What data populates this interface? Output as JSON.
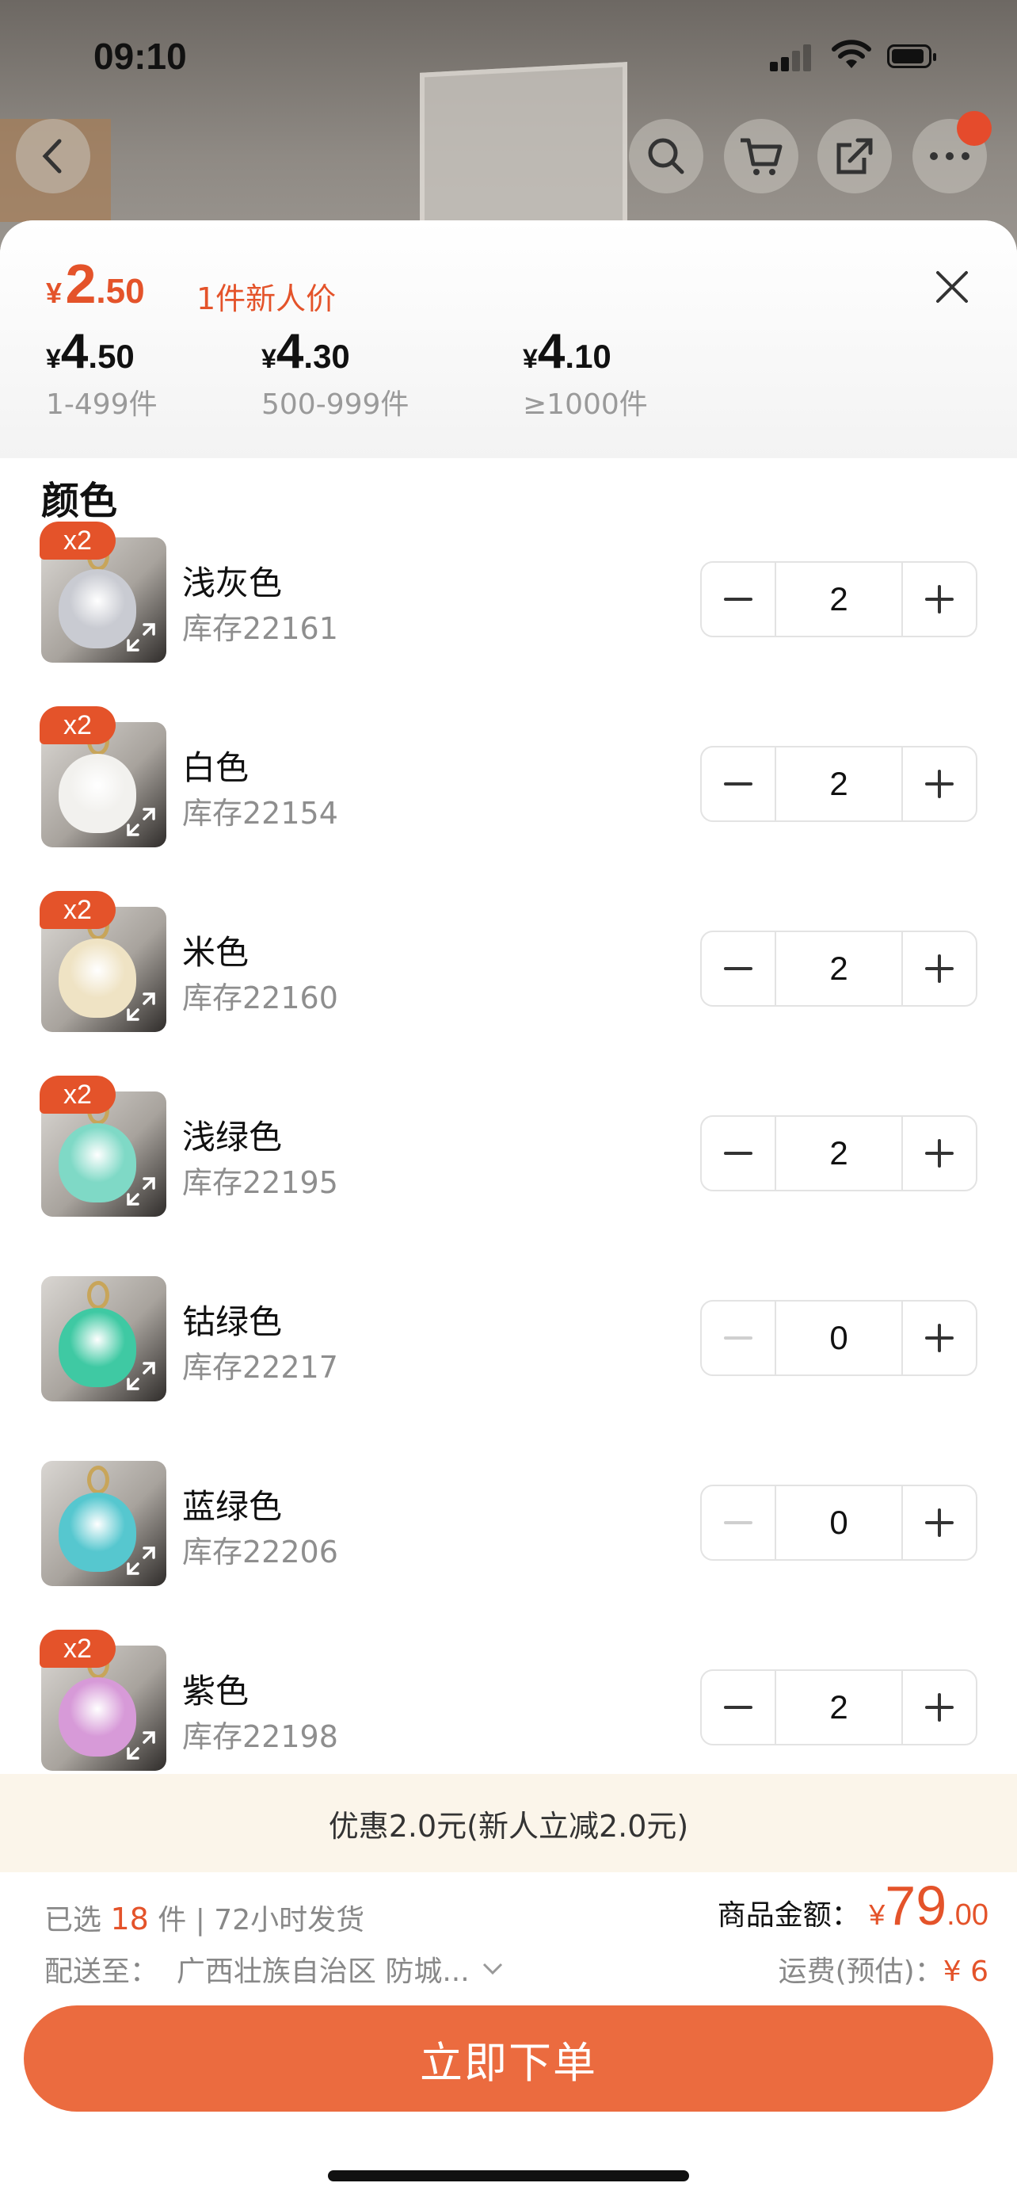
{
  "status": {
    "time": "09:10"
  },
  "header_icons": [
    "back-icon",
    "search-icon",
    "cart-icon",
    "share-icon",
    "more-icon"
  ],
  "price": {
    "currency": "¥",
    "current_int": "2",
    "current_dec": ".50",
    "new_user_label": "1件新人价",
    "tiers": [
      {
        "currency": "¥",
        "int": "4",
        "dec": ".50",
        "range": "1-499件"
      },
      {
        "currency": "¥",
        "int": "4",
        "dec": ".30",
        "range": "500-999件"
      },
      {
        "currency": "¥",
        "int": "4",
        "dec": ".10",
        "range": "≥1000件"
      }
    ]
  },
  "color_section": {
    "title": "颜色"
  },
  "variants": [
    {
      "tag": "x2",
      "name": "浅灰色",
      "stock": "库存22161",
      "qty": "2",
      "toy_color": "#c9cbd2",
      "minus_active": true
    },
    {
      "tag": "x2",
      "name": "白色",
      "stock": "库存22154",
      "qty": "2",
      "toy_color": "#f2f1ee",
      "minus_active": true
    },
    {
      "tag": "x2",
      "name": "米色",
      "stock": "库存22160",
      "qty": "2",
      "toy_color": "#efe3c4",
      "minus_active": true
    },
    {
      "tag": "x2",
      "name": "浅绿色",
      "stock": "库存22195",
      "qty": "2",
      "toy_color": "#7fd9c6",
      "minus_active": true
    },
    {
      "tag": "",
      "name": "钴绿色",
      "stock": "库存22217",
      "qty": "0",
      "toy_color": "#3fc9a3",
      "minus_active": false
    },
    {
      "tag": "",
      "name": "蓝绿色",
      "stock": "库存22206",
      "qty": "0",
      "toy_color": "#56c7cf",
      "minus_active": false
    },
    {
      "tag": "x2",
      "name": "紫色",
      "stock": "库存22198",
      "qty": "2",
      "toy_color": "#d79ad8",
      "minus_active": true
    }
  ],
  "promo": "优惠2.0元(新人立减2.0元)",
  "summary": {
    "selected_prefix": "已选",
    "selected_count": "18",
    "selected_suffix": "件 | 72小时发货",
    "ship_to_label": "配送至：",
    "ship_to_value": "广西壮族自治区 防城...",
    "amount_label": "商品金额：",
    "amount_currency": "¥",
    "amount_int": "79",
    "amount_dec": ".00",
    "freight_label": "运费(预估)：",
    "freight_value": "¥ 6"
  },
  "order_button": "立即下单",
  "colors": {
    "accent": "#e4532a",
    "button": "#eb6b3f",
    "promo_bg": "#fbf5ea"
  }
}
